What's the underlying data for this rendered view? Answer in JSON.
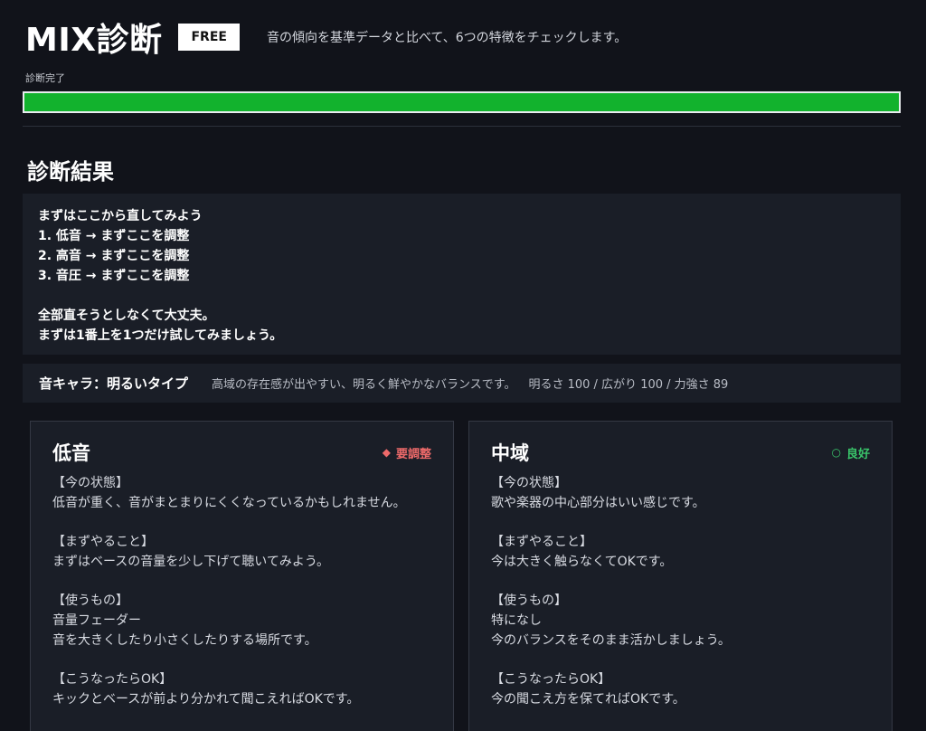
{
  "header": {
    "title": "MIX診断",
    "badge": "FREE",
    "tagline": "音の傾向を基準データと比べて、6つの特徴をチェックします。"
  },
  "status": {
    "label": "診断完了",
    "progress_percent": 100
  },
  "colors": {
    "progress": "#12b22d",
    "warn": "#ee6a6a",
    "good": "#39c46a"
  },
  "results": {
    "title": "診断結果",
    "advice": {
      "heading": "まずはここから直してみよう",
      "items": [
        "1. 低音 → まずここを調整",
        "2. 高音 → まずここを調整",
        "3. 音圧 → まずここを調整"
      ],
      "note1": "全部直そうとしなくて大丈夫。",
      "note2": "まずは1番上を1つだけ試してみましょう。"
    },
    "character": {
      "title": "音キャラ：明るいタイプ",
      "description": "高域の存在感が出やすい、明るく鮮やかなバランスです。",
      "stats": "明るさ 100 / 広がり 100 / 力強さ 89"
    },
    "cards": [
      {
        "title": "低音",
        "status": "要調整",
        "status_icon": "diamond-icon",
        "current_label": "【今の状態】",
        "current": "低音が重く、音がまとまりにくくなっているかもしれません。",
        "todo_label": "【まずやること】",
        "todo": "まずはベースの音量を少し下げて聴いてみよう。",
        "tools_label": "【使うもの】",
        "tools1": "音量フェーダー",
        "tools2": "音を大きくしたり小さくしたりする場所です。",
        "ok_label": "【こうなったらOK】",
        "ok": "キックとベースが前より分かれて聞こえればOKです。"
      },
      {
        "title": "中域",
        "status": "良好",
        "status_icon": "circle-icon",
        "current_label": "【今の状態】",
        "current": "歌や楽器の中心部分はいい感じです。",
        "todo_label": "【まずやること】",
        "todo": "今は大きく触らなくてOKです。",
        "tools_label": "【使うもの】",
        "tools1": "特になし",
        "tools2": "今のバランスをそのまま活かしましょう。",
        "ok_label": "【こうなったらOK】",
        "ok": "今の聞こえ方を保てればOKです。"
      }
    ]
  }
}
